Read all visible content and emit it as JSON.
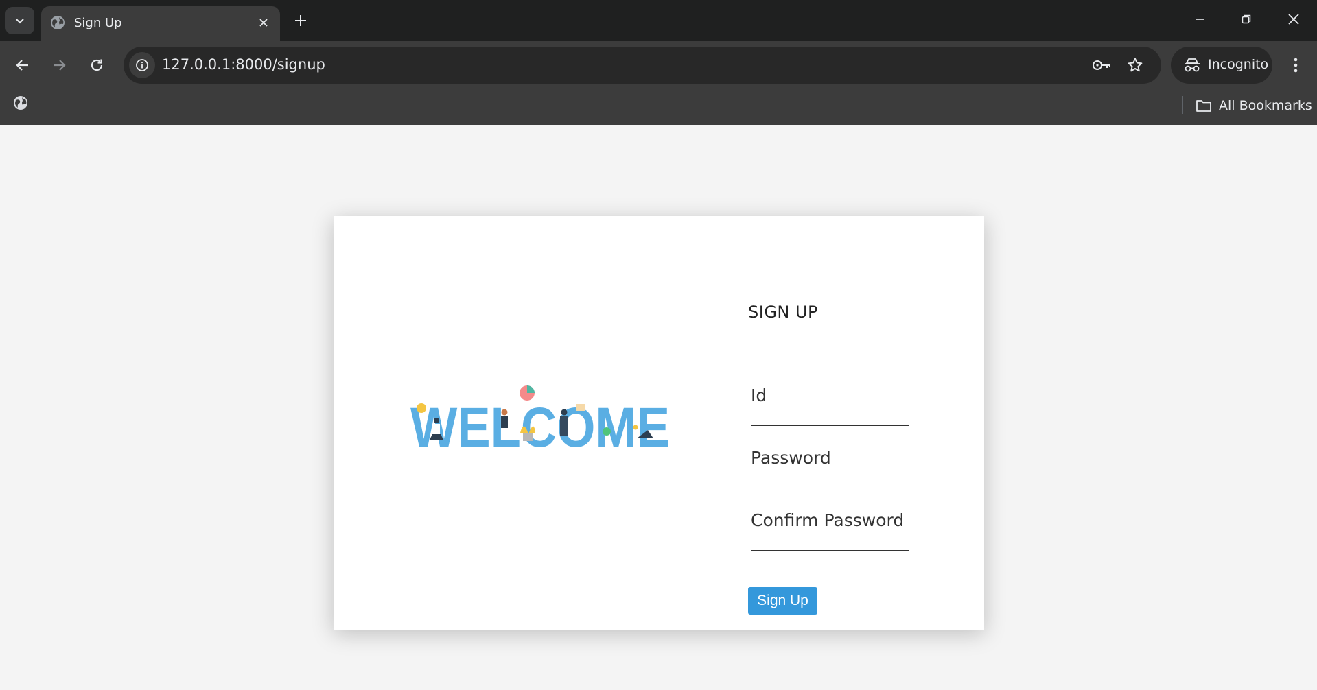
{
  "browser": {
    "tab_title": "Sign Up",
    "url": "127.0.0.1:8000/signup",
    "incognito_label": "Incognito",
    "bookmarks_label": "All Bookmarks"
  },
  "page": {
    "welcome_text": "WELCOME",
    "form_title": "SIGN UP",
    "fields": {
      "id": {
        "label": "Id",
        "value": ""
      },
      "password": {
        "label": "Password",
        "value": ""
      },
      "confirm_password": {
        "label": "Confirm Password",
        "value": ""
      }
    },
    "submit_label": "Sign Up"
  },
  "colors": {
    "accent": "#3498db",
    "welcome_letters": "#5aaee3",
    "chrome_dark": "#1f2020",
    "chrome_toolbar": "#3c3c3c",
    "page_bg": "#f4f4f4"
  }
}
